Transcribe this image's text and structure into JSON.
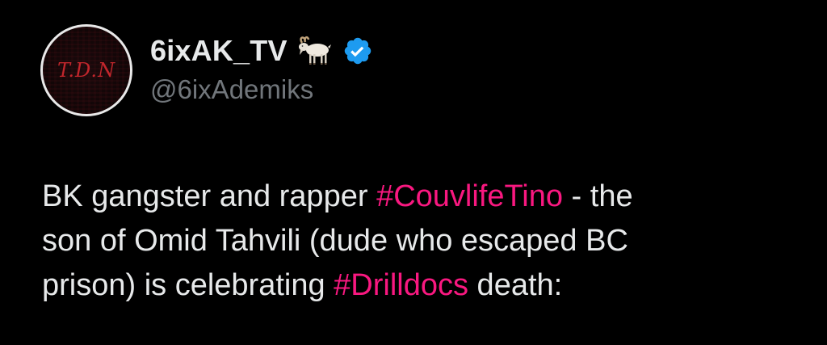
{
  "tweet": {
    "author": {
      "display_name": "6ixAK_TV",
      "handle": "@6ixAdemiks",
      "avatar_text": "T.D.N",
      "badge_icon": "goat-emoji-icon",
      "verified_icon": "verified-badge-icon"
    },
    "text": {
      "line1_before": "BK gangster and rapper ",
      "hashtag1": "#CouvlifeTino",
      "line1_after": " - the",
      "line2": "son of Omid Tahvili (dude who escaped BC",
      "line3_before": "prison) is celebrating ",
      "hashtag2": "#Drilldocs",
      "line3_after": " death:"
    }
  },
  "colors": {
    "background": "#000000",
    "text": "#e7e9ea",
    "secondary_text": "#71767b",
    "hashtag": "#f91880",
    "verified": "#1d9bf0",
    "avatar_logo": "#c2262c"
  }
}
